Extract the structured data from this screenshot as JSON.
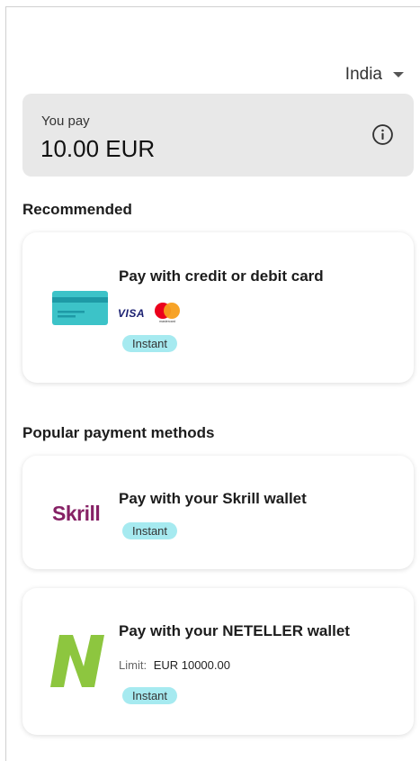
{
  "header": {
    "country": "India"
  },
  "payment": {
    "label": "You pay",
    "amount": "10.00 EUR"
  },
  "sections": {
    "recommended": "Recommended",
    "popular": "Popular payment methods"
  },
  "methods": {
    "card": {
      "title": "Pay with credit or debit card",
      "brands": [
        "VISA",
        "mastercard"
      ],
      "badge": "Instant"
    },
    "skrill": {
      "logo_text": "Skrill",
      "title": "Pay with your Skrill wallet",
      "badge": "Instant"
    },
    "neteller": {
      "title": "Pay with your NETELLER wallet",
      "limit_label": "Limit:",
      "limit_value": "EUR 10000.00",
      "badge": "Instant"
    }
  },
  "colors": {
    "badge_bg": "#a6eaf0",
    "skrill_brand": "#862165",
    "neteller_brand": "#8dc63f",
    "card_icon": "#3cc3c8"
  },
  "icons": [
    "chevron-down-icon",
    "info-icon",
    "credit-card-icon",
    "mastercard-logo-icon",
    "neteller-logo-icon"
  ]
}
